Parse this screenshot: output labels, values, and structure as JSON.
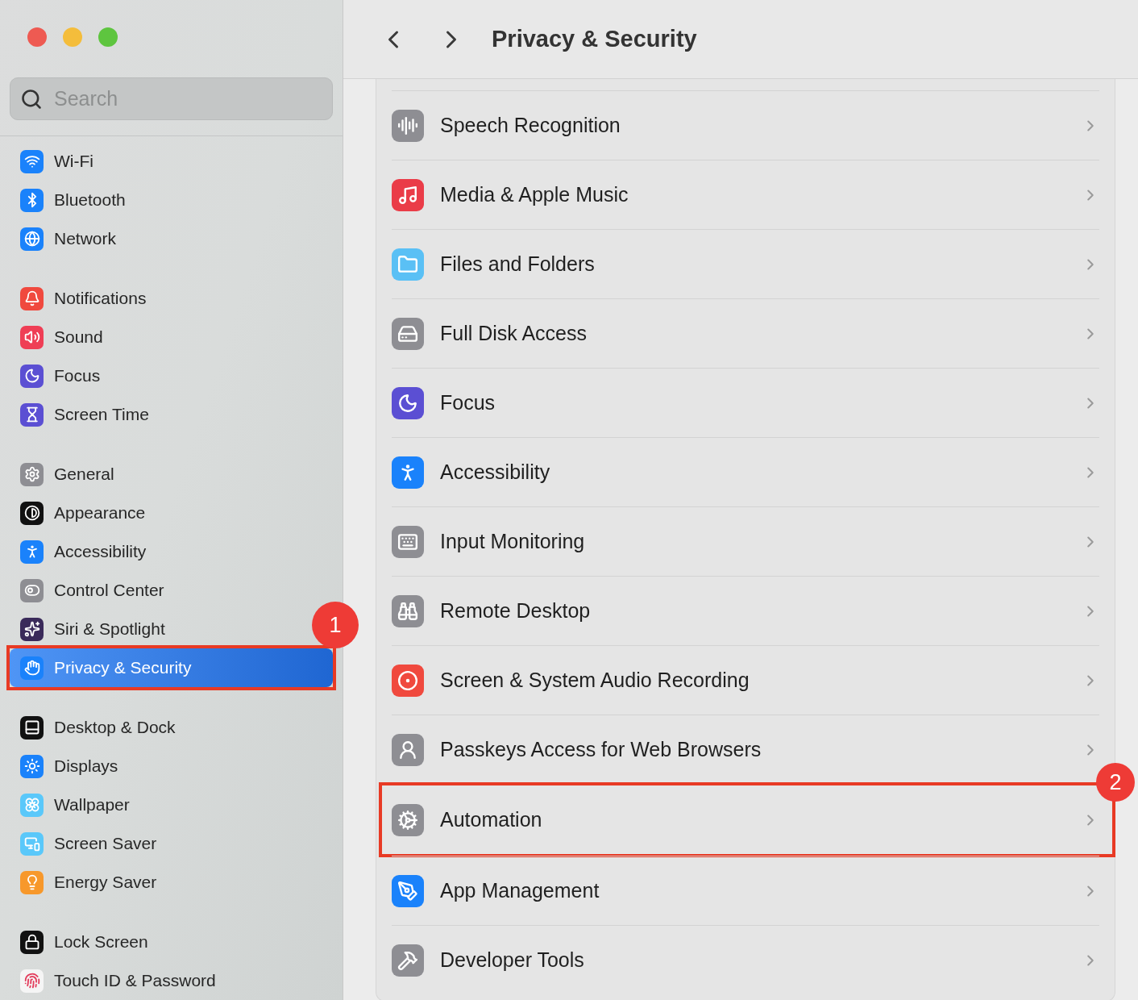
{
  "window": {
    "title": "Privacy & Security"
  },
  "search": {
    "placeholder": "Search"
  },
  "sidebar": {
    "groups": [
      {
        "items": [
          {
            "label": "Wi-Fi",
            "selected": false
          },
          {
            "label": "Bluetooth",
            "selected": false
          },
          {
            "label": "Network",
            "selected": false
          }
        ]
      },
      {
        "items": [
          {
            "label": "Notifications",
            "selected": false
          },
          {
            "label": "Sound",
            "selected": false
          },
          {
            "label": "Focus",
            "selected": false
          },
          {
            "label": "Screen Time",
            "selected": false
          }
        ]
      },
      {
        "items": [
          {
            "label": "General",
            "selected": false
          },
          {
            "label": "Appearance",
            "selected": false
          },
          {
            "label": "Accessibility",
            "selected": false
          },
          {
            "label": "Control Center",
            "selected": false
          },
          {
            "label": "Siri & Spotlight",
            "selected": false
          },
          {
            "label": "Privacy & Security",
            "selected": true,
            "callout": "1"
          }
        ]
      },
      {
        "items": [
          {
            "label": "Desktop & Dock",
            "selected": false
          },
          {
            "label": "Displays",
            "selected": false
          },
          {
            "label": "Wallpaper",
            "selected": false
          },
          {
            "label": "Screen Saver",
            "selected": false
          },
          {
            "label": "Energy Saver",
            "selected": false
          }
        ]
      },
      {
        "items": [
          {
            "label": "Lock Screen",
            "selected": false
          },
          {
            "label": "Touch ID & Password",
            "selected": false
          }
        ]
      }
    ]
  },
  "rows": [
    {
      "label": "Speech Recognition"
    },
    {
      "label": "Media & Apple Music"
    },
    {
      "label": "Files and Folders"
    },
    {
      "label": "Full Disk Access"
    },
    {
      "label": "Focus"
    },
    {
      "label": "Accessibility"
    },
    {
      "label": "Input Monitoring"
    },
    {
      "label": "Remote Desktop"
    },
    {
      "label": "Screen & System Audio Recording"
    },
    {
      "label": "Passkeys Access for Web Browsers"
    },
    {
      "label": "Automation",
      "callout": "2"
    },
    {
      "label": "App Management"
    },
    {
      "label": "Developer Tools"
    }
  ]
}
